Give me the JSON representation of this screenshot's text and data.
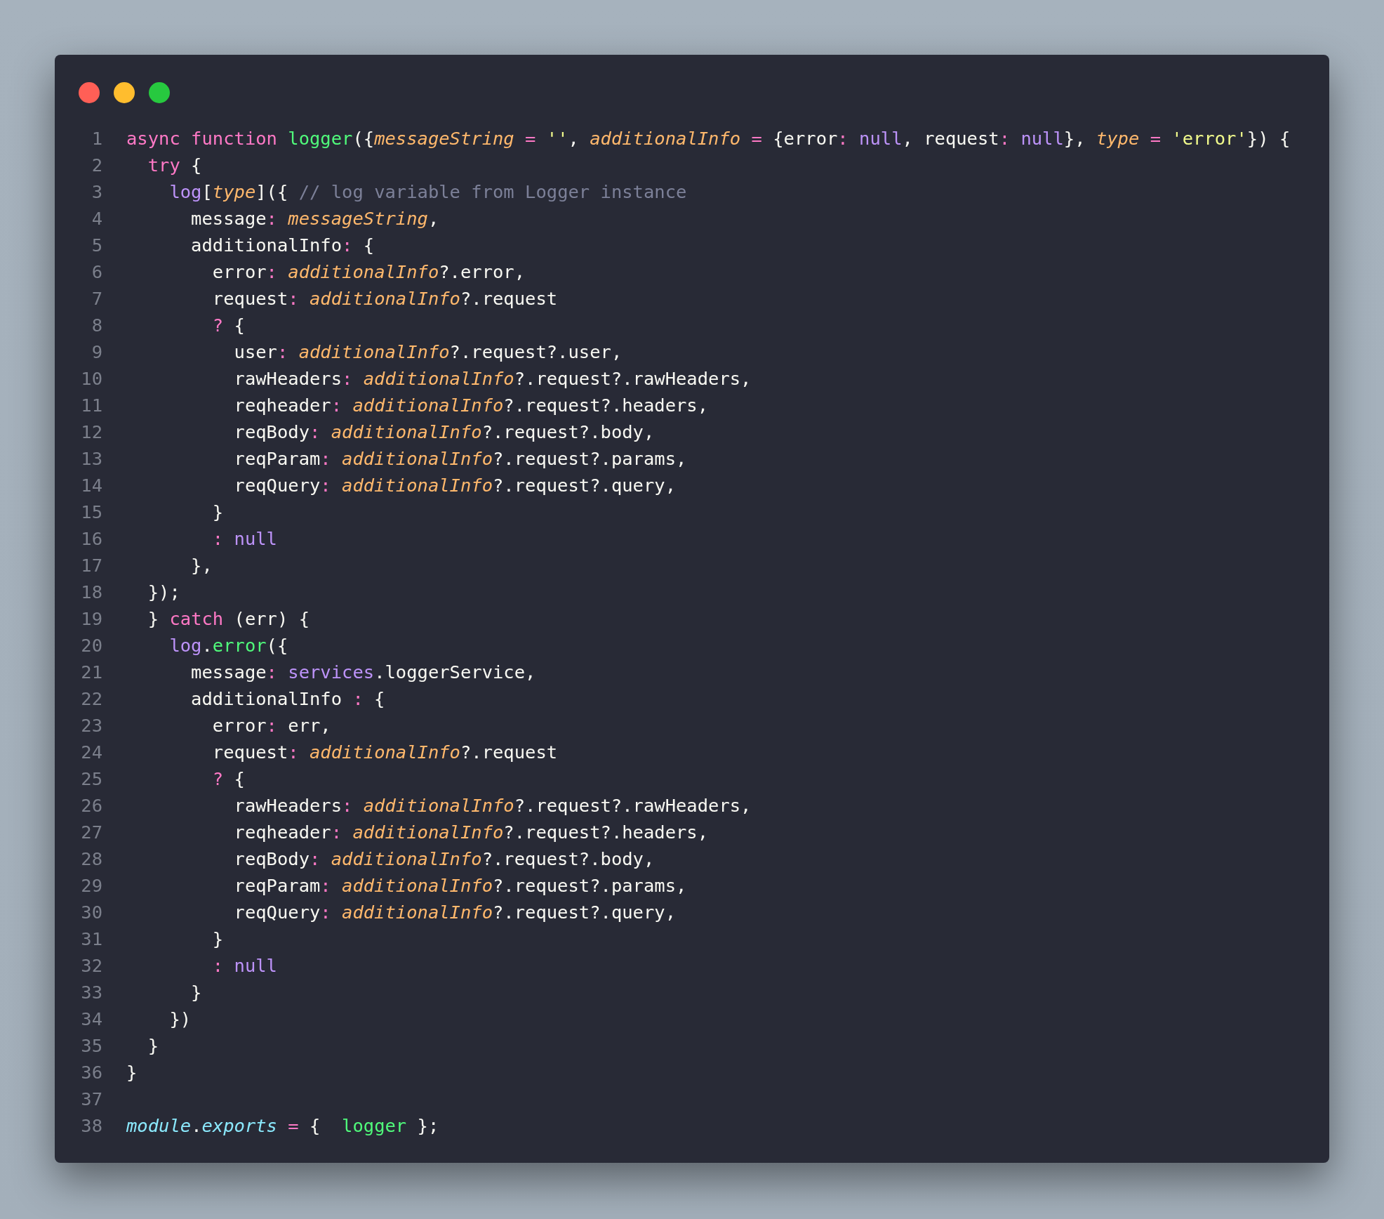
{
  "window": {
    "controls": [
      {
        "kind": "close"
      },
      {
        "kind": "minimize"
      },
      {
        "kind": "maximize"
      }
    ]
  },
  "code": {
    "lines": [
      {
        "number": "1",
        "tokens": [
          {
            "kind": "keyword",
            "text": "async function "
          },
          {
            "kind": "function",
            "text": "logger"
          },
          {
            "kind": "plain",
            "text": "({"
          },
          {
            "kind": "param",
            "text": "messageString"
          },
          {
            "kind": "operator",
            "text": " = "
          },
          {
            "kind": "string",
            "text": "''"
          },
          {
            "kind": "plain",
            "text": ", "
          },
          {
            "kind": "param",
            "text": "additionalInfo"
          },
          {
            "kind": "operator",
            "text": " = "
          },
          {
            "kind": "plain",
            "text": "{error"
          },
          {
            "kind": "operator",
            "text": ": "
          },
          {
            "kind": "literal",
            "text": "null"
          },
          {
            "kind": "plain",
            "text": ", request"
          },
          {
            "kind": "operator",
            "text": ": "
          },
          {
            "kind": "literal",
            "text": "null"
          },
          {
            "kind": "plain",
            "text": "}, "
          },
          {
            "kind": "param",
            "text": "type"
          },
          {
            "kind": "operator",
            "text": " = "
          },
          {
            "kind": "string",
            "text": "'error'"
          },
          {
            "kind": "plain",
            "text": "}) {"
          }
        ]
      },
      {
        "number": "2",
        "tokens": [
          {
            "kind": "keyword",
            "text": "  try"
          },
          {
            "kind": "plain",
            "text": " {"
          }
        ]
      },
      {
        "number": "3",
        "tokens": [
          {
            "kind": "variable",
            "text": "    log"
          },
          {
            "kind": "plain",
            "text": "["
          },
          {
            "kind": "param",
            "text": "type"
          },
          {
            "kind": "plain",
            "text": "]({ "
          },
          {
            "kind": "comment",
            "text": "// log variable from Logger instance"
          }
        ]
      },
      {
        "number": "4",
        "tokens": [
          {
            "kind": "plain",
            "text": "      message"
          },
          {
            "kind": "operator",
            "text": ": "
          },
          {
            "kind": "param",
            "text": "messageString"
          },
          {
            "kind": "plain",
            "text": ","
          }
        ]
      },
      {
        "number": "5",
        "tokens": [
          {
            "kind": "plain",
            "text": "      additionalInfo"
          },
          {
            "kind": "operator",
            "text": ": "
          },
          {
            "kind": "plain",
            "text": "{"
          }
        ]
      },
      {
        "number": "6",
        "tokens": [
          {
            "kind": "plain",
            "text": "        error"
          },
          {
            "kind": "operator",
            "text": ": "
          },
          {
            "kind": "param",
            "text": "additionalInfo"
          },
          {
            "kind": "plain",
            "text": "?.error,"
          }
        ]
      },
      {
        "number": "7",
        "tokens": [
          {
            "kind": "plain",
            "text": "        request"
          },
          {
            "kind": "operator",
            "text": ": "
          },
          {
            "kind": "param",
            "text": "additionalInfo"
          },
          {
            "kind": "plain",
            "text": "?.request"
          }
        ]
      },
      {
        "number": "8",
        "tokens": [
          {
            "kind": "operator",
            "text": "        ?"
          },
          {
            "kind": "plain",
            "text": " {"
          }
        ]
      },
      {
        "number": "9",
        "tokens": [
          {
            "kind": "plain",
            "text": "          user"
          },
          {
            "kind": "operator",
            "text": ": "
          },
          {
            "kind": "param",
            "text": "additionalInfo"
          },
          {
            "kind": "plain",
            "text": "?.request?.user,"
          }
        ]
      },
      {
        "number": "10",
        "tokens": [
          {
            "kind": "plain",
            "text": "          rawHeaders"
          },
          {
            "kind": "operator",
            "text": ": "
          },
          {
            "kind": "param",
            "text": "additionalInfo"
          },
          {
            "kind": "plain",
            "text": "?.request?.rawHeaders,"
          }
        ]
      },
      {
        "number": "11",
        "tokens": [
          {
            "kind": "plain",
            "text": "          reqheader"
          },
          {
            "kind": "operator",
            "text": ": "
          },
          {
            "kind": "param",
            "text": "additionalInfo"
          },
          {
            "kind": "plain",
            "text": "?.request?.headers,"
          }
        ]
      },
      {
        "number": "12",
        "tokens": [
          {
            "kind": "plain",
            "text": "          reqBody"
          },
          {
            "kind": "operator",
            "text": ": "
          },
          {
            "kind": "param",
            "text": "additionalInfo"
          },
          {
            "kind": "plain",
            "text": "?.request?.body,"
          }
        ]
      },
      {
        "number": "13",
        "tokens": [
          {
            "kind": "plain",
            "text": "          reqParam"
          },
          {
            "kind": "operator",
            "text": ": "
          },
          {
            "kind": "param",
            "text": "additionalInfo"
          },
          {
            "kind": "plain",
            "text": "?.request?.params,"
          }
        ]
      },
      {
        "number": "14",
        "tokens": [
          {
            "kind": "plain",
            "text": "          reqQuery"
          },
          {
            "kind": "operator",
            "text": ": "
          },
          {
            "kind": "param",
            "text": "additionalInfo"
          },
          {
            "kind": "plain",
            "text": "?.request?.query,"
          }
        ]
      },
      {
        "number": "15",
        "tokens": [
          {
            "kind": "plain",
            "text": "        }"
          }
        ]
      },
      {
        "number": "16",
        "tokens": [
          {
            "kind": "operator",
            "text": "        : "
          },
          {
            "kind": "literal",
            "text": "null"
          }
        ]
      },
      {
        "number": "17",
        "tokens": [
          {
            "kind": "plain",
            "text": "      },"
          }
        ]
      },
      {
        "number": "18",
        "tokens": [
          {
            "kind": "plain",
            "text": "  });"
          }
        ]
      },
      {
        "number": "19",
        "tokens": [
          {
            "kind": "plain",
            "text": "  } "
          },
          {
            "kind": "keyword",
            "text": "catch"
          },
          {
            "kind": "plain",
            "text": " (err) {"
          }
        ]
      },
      {
        "number": "20",
        "tokens": [
          {
            "kind": "variable",
            "text": "    log"
          },
          {
            "kind": "plain",
            "text": "."
          },
          {
            "kind": "function",
            "text": "error"
          },
          {
            "kind": "plain",
            "text": "({"
          }
        ]
      },
      {
        "number": "21",
        "tokens": [
          {
            "kind": "plain",
            "text": "      message"
          },
          {
            "kind": "operator",
            "text": ": "
          },
          {
            "kind": "variable",
            "text": "services"
          },
          {
            "kind": "plain",
            "text": ".loggerService,"
          }
        ]
      },
      {
        "number": "22",
        "tokens": [
          {
            "kind": "plain",
            "text": "      additionalInfo "
          },
          {
            "kind": "operator",
            "text": ":"
          },
          {
            "kind": "plain",
            "text": " {"
          }
        ]
      },
      {
        "number": "23",
        "tokens": [
          {
            "kind": "plain",
            "text": "        error"
          },
          {
            "kind": "operator",
            "text": ": "
          },
          {
            "kind": "plain",
            "text": "err,"
          }
        ]
      },
      {
        "number": "24",
        "tokens": [
          {
            "kind": "plain",
            "text": "        request"
          },
          {
            "kind": "operator",
            "text": ": "
          },
          {
            "kind": "param",
            "text": "additionalInfo"
          },
          {
            "kind": "plain",
            "text": "?.request"
          }
        ]
      },
      {
        "number": "25",
        "tokens": [
          {
            "kind": "operator",
            "text": "        ?"
          },
          {
            "kind": "plain",
            "text": " {"
          }
        ]
      },
      {
        "number": "26",
        "tokens": [
          {
            "kind": "plain",
            "text": "          rawHeaders"
          },
          {
            "kind": "operator",
            "text": ": "
          },
          {
            "kind": "param",
            "text": "additionalInfo"
          },
          {
            "kind": "plain",
            "text": "?.request?.rawHeaders,"
          }
        ]
      },
      {
        "number": "27",
        "tokens": [
          {
            "kind": "plain",
            "text": "          reqheader"
          },
          {
            "kind": "operator",
            "text": ": "
          },
          {
            "kind": "param",
            "text": "additionalInfo"
          },
          {
            "kind": "plain",
            "text": "?.request?.headers,"
          }
        ]
      },
      {
        "number": "28",
        "tokens": [
          {
            "kind": "plain",
            "text": "          reqBody"
          },
          {
            "kind": "operator",
            "text": ": "
          },
          {
            "kind": "param",
            "text": "additionalInfo"
          },
          {
            "kind": "plain",
            "text": "?.request?.body,"
          }
        ]
      },
      {
        "number": "29",
        "tokens": [
          {
            "kind": "plain",
            "text": "          reqParam"
          },
          {
            "kind": "operator",
            "text": ": "
          },
          {
            "kind": "param",
            "text": "additionalInfo"
          },
          {
            "kind": "plain",
            "text": "?.request?.params,"
          }
        ]
      },
      {
        "number": "30",
        "tokens": [
          {
            "kind": "plain",
            "text": "          reqQuery"
          },
          {
            "kind": "operator",
            "text": ": "
          },
          {
            "kind": "param",
            "text": "additionalInfo"
          },
          {
            "kind": "plain",
            "text": "?.request?.query,"
          }
        ]
      },
      {
        "number": "31",
        "tokens": [
          {
            "kind": "plain",
            "text": "        }"
          }
        ]
      },
      {
        "number": "32",
        "tokens": [
          {
            "kind": "operator",
            "text": "        : "
          },
          {
            "kind": "literal",
            "text": "null"
          }
        ]
      },
      {
        "number": "33",
        "tokens": [
          {
            "kind": "plain",
            "text": "      }"
          }
        ]
      },
      {
        "number": "34",
        "tokens": [
          {
            "kind": "plain",
            "text": "    })"
          }
        ]
      },
      {
        "number": "35",
        "tokens": [
          {
            "kind": "plain",
            "text": "  }"
          }
        ]
      },
      {
        "number": "36",
        "tokens": [
          {
            "kind": "plain",
            "text": "}"
          }
        ]
      },
      {
        "number": "37"
      },
      {
        "number": "38",
        "tokens": [
          {
            "kind": "builtin",
            "text": "module"
          },
          {
            "kind": "plain",
            "text": "."
          },
          {
            "kind": "builtin",
            "text": "exports"
          },
          {
            "kind": "operator",
            "text": " = "
          },
          {
            "kind": "plain",
            "text": "{  "
          },
          {
            "kind": "function",
            "text": "logger"
          },
          {
            "kind": "plain",
            "text": " };"
          }
        ]
      }
    ]
  }
}
